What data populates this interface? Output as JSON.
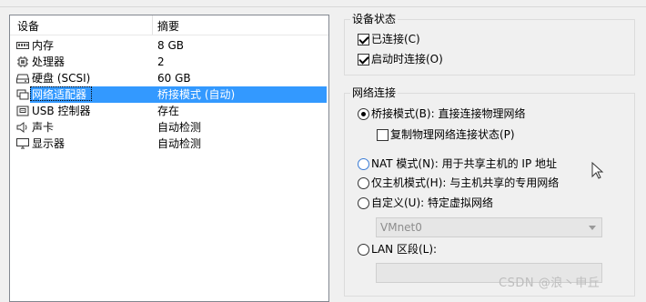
{
  "device_list": {
    "headers": {
      "device": "设备",
      "summary": "摘要"
    },
    "rows": [
      {
        "icon": "memory-icon",
        "name": "内存",
        "value": "8 GB"
      },
      {
        "icon": "processor-icon",
        "name": "处理器",
        "value": "2"
      },
      {
        "icon": "hard-disk-icon",
        "name": "硬盘 (SCSI)",
        "value": "60 GB"
      },
      {
        "icon": "network-adapter-icon",
        "name": "网络适配器",
        "value": "桥接模式 (自动)"
      },
      {
        "icon": "usb-icon",
        "name": "USB 控制器",
        "value": "存在"
      },
      {
        "icon": "sound-icon",
        "name": "声卡",
        "value": "自动检测"
      },
      {
        "icon": "display-icon",
        "name": "显示器",
        "value": "自动检测"
      }
    ]
  },
  "device_status": {
    "title": "设备状态",
    "connected": "已连接(C)",
    "connect_at_power_on": "启动时连接(O)"
  },
  "network_connection": {
    "title": "网络连接",
    "bridged": "桥接模式(B): 直接连接物理网络",
    "replicate": "复制物理网络连接状态(P)",
    "nat": "NAT 模式(N): 用于共享主机的 IP 地址",
    "host_only": "仅主机模式(H): 与主机共享的专用网络",
    "custom": "自定义(U): 特定虚拟网络",
    "vmnet_value": "VMnet0",
    "lan_segment": "LAN 区段(L):"
  },
  "watermark": "CSDN @浪丶申丘",
  "colors": {
    "selection": "#3399ff",
    "panel_bg": "#f0f0f0"
  }
}
